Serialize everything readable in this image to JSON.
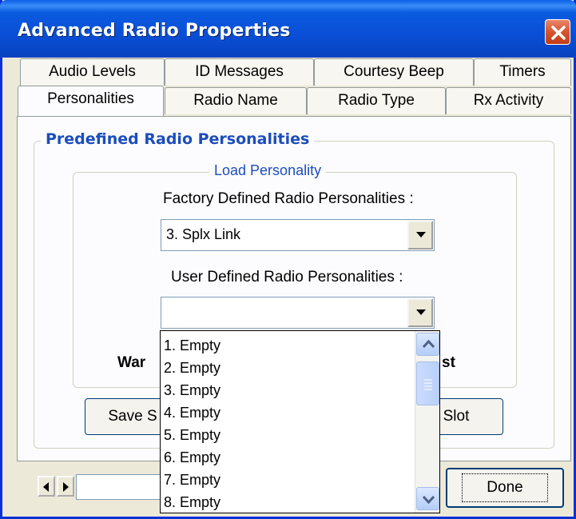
{
  "window": {
    "title": "Advanced Radio Properties"
  },
  "tabs": {
    "row1": [
      "Audio Levels",
      "ID Messages",
      "Courtesy Beep",
      "Timers"
    ],
    "row2": [
      "Personalities",
      "Radio Name",
      "Radio Type",
      "Rx Activity"
    ],
    "active": "Personalities"
  },
  "predefined": {
    "group_title": "Predefined Radio Personalities",
    "load": {
      "group_title": "Load Personality",
      "factory_label": "Factory Defined Radio Personalities :",
      "factory_value": "3. Splx Link",
      "user_label": "User Defined Radio Personalities :",
      "user_value": "",
      "warning_left": "War",
      "warning_right": "st"
    },
    "save_button_partial": "Save S",
    "slot_button_partial": "r Slot"
  },
  "dropdown": {
    "items": [
      "1. Empty",
      "2. Empty",
      "3. Empty",
      "4. Empty",
      "5. Empty",
      "6. Empty",
      "7. Empty",
      "8. Empty"
    ]
  },
  "footer": {
    "done_label": "Done",
    "text_value": ""
  },
  "icons": [
    "close-icon",
    "chevron-down-icon",
    "scroll-up-icon",
    "scroll-down-icon",
    "scroll-left-icon",
    "scroll-right-icon"
  ],
  "colors": {
    "titlebar": "#0a4fd6",
    "group_title": "#1c4dbc",
    "face": "#ece9d8",
    "close": "#d8542c"
  }
}
